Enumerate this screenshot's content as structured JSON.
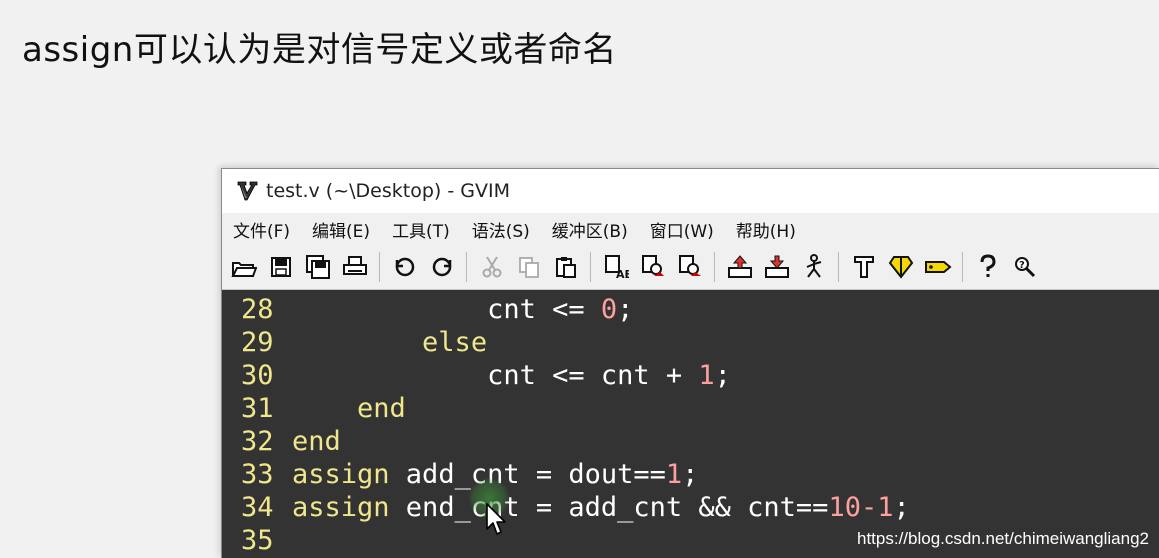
{
  "slide": {
    "title": "assign可以认为是对信号定义或者命名"
  },
  "window": {
    "title": "test.v (~\\Desktop) - GVIM",
    "app_icon": "vim-icon"
  },
  "menubar": {
    "items": [
      "文件(F)",
      "编辑(E)",
      "工具(T)",
      "语法(S)",
      "缓冲区(B)",
      "窗口(W)",
      "帮助(H)"
    ]
  },
  "toolbar": {
    "icons": [
      "open-icon",
      "save-icon",
      "save-all-icon",
      "print-icon",
      "undo-icon",
      "redo-icon",
      "cut-icon",
      "copy-icon",
      "paste-icon",
      "replace-icon",
      "find-next-icon",
      "find-prev-icon",
      "load-session-icon",
      "save-session-icon",
      "run-script-icon",
      "make-icon",
      "build-tags-icon",
      "jump-tag-icon",
      "help-icon",
      "find-help-icon"
    ]
  },
  "editor": {
    "lines": [
      {
        "num": "28",
        "tokens": [
          {
            "t": "            cnt ",
            "c": "code"
          },
          {
            "t": "<=",
            "c": "op"
          },
          {
            "t": " ",
            "c": "code"
          },
          {
            "t": "0",
            "c": "num"
          },
          {
            "t": ";",
            "c": "code"
          }
        ]
      },
      {
        "num": "29",
        "tokens": [
          {
            "t": "        ",
            "c": "code"
          },
          {
            "t": "else",
            "c": "kw"
          }
        ]
      },
      {
        "num": "30",
        "tokens": [
          {
            "t": "            cnt ",
            "c": "code"
          },
          {
            "t": "<=",
            "c": "op"
          },
          {
            "t": " cnt + ",
            "c": "code"
          },
          {
            "t": "1",
            "c": "num"
          },
          {
            "t": ";",
            "c": "code"
          }
        ]
      },
      {
        "num": "31",
        "tokens": [
          {
            "t": "    ",
            "c": "code"
          },
          {
            "t": "end",
            "c": "kw"
          }
        ]
      },
      {
        "num": "32",
        "tokens": [
          {
            "t": "end",
            "c": "kw"
          }
        ]
      },
      {
        "num": "33",
        "tokens": [
          {
            "t": "assign",
            "c": "kw"
          },
          {
            "t": " add_cnt = dout==",
            "c": "code"
          },
          {
            "t": "1",
            "c": "num"
          },
          {
            "t": ";",
            "c": "code"
          }
        ]
      },
      {
        "num": "34",
        "tokens": [
          {
            "t": "assign",
            "c": "kw"
          },
          {
            "t": " end_cnt = add_cnt && cnt==",
            "c": "code"
          },
          {
            "t": "10-1",
            "c": "num"
          },
          {
            "t": ";",
            "c": "code"
          }
        ]
      },
      {
        "num": "35",
        "tokens": []
      }
    ]
  },
  "watermark": {
    "text": "https://blog.csdn.net/chimeiwangliang2"
  },
  "colors": {
    "editor_bg": "#333333",
    "line_number": "#f0e68c",
    "keyword": "#f0e68c",
    "number": "#ffa0a0",
    "text": "#ffffff"
  }
}
